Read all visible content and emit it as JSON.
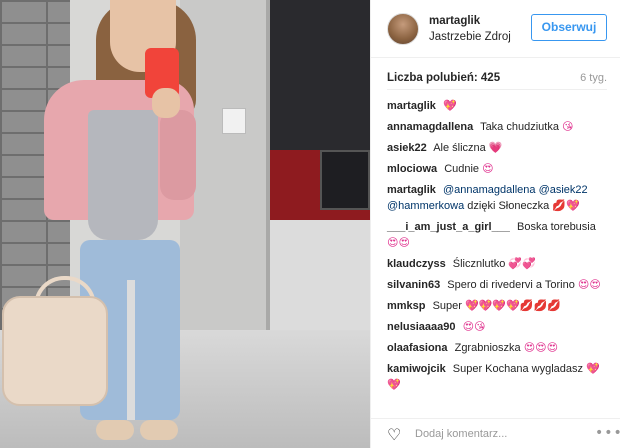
{
  "post": {
    "username": "martaglik",
    "location": "Jastrzebie Zdroj",
    "follow_label": "Obserwuj",
    "likes": "Liczba polubień: 425",
    "age": "6 tyg.",
    "comment_placeholder": "Dodaj komentarz...",
    "more_label": "•••"
  },
  "icons": {
    "heart": "heart-outline-icon",
    "more": "ellipsis-icon"
  },
  "colors": {
    "accent": "#3897f0",
    "text": "#262626",
    "muted": "#999999",
    "emoji": "#e0338f"
  },
  "comments": [
    {
      "author": "martaglik",
      "text": "",
      "emoji": "💖"
    },
    {
      "author": "annamagdallena",
      "text": "Taka chudziutka",
      "emoji": "😘"
    },
    {
      "author": "asiek22",
      "text": "Ale śliczna",
      "emoji": "💗"
    },
    {
      "author": "mlociowa",
      "text": "Cudnie",
      "emoji": "😍"
    },
    {
      "author": "martaglik",
      "mention1": "@annamagdallena",
      "mention2": "@asiek22",
      "mention3": "@hammerkowa",
      "text": "dzięki Słoneczka",
      "emoji": "💋💖"
    },
    {
      "author": "___i_am_just_a_girl___",
      "text": "Boska torebusia",
      "emoji": "😍😍"
    },
    {
      "author": "klaudczyss",
      "text": "Ślicznlutko",
      "emoji": "💞💞"
    },
    {
      "author": "silvanin63",
      "text": "Spero di rivedervi a Torino",
      "emoji": "😍😍"
    },
    {
      "author": "mmksp",
      "text": "Super",
      "emoji": "💖💖💖💖💋💋💋"
    },
    {
      "author": "nelusiaaaa90",
      "text": "",
      "emoji": "😍😘"
    },
    {
      "author": "olaafasiona",
      "text": "Zgrabnioszka",
      "emoji": "😍😍😍"
    },
    {
      "author": "kamiwojcik",
      "text": "Super Kochana wygladasz",
      "emoji": "💖💖"
    }
  ]
}
